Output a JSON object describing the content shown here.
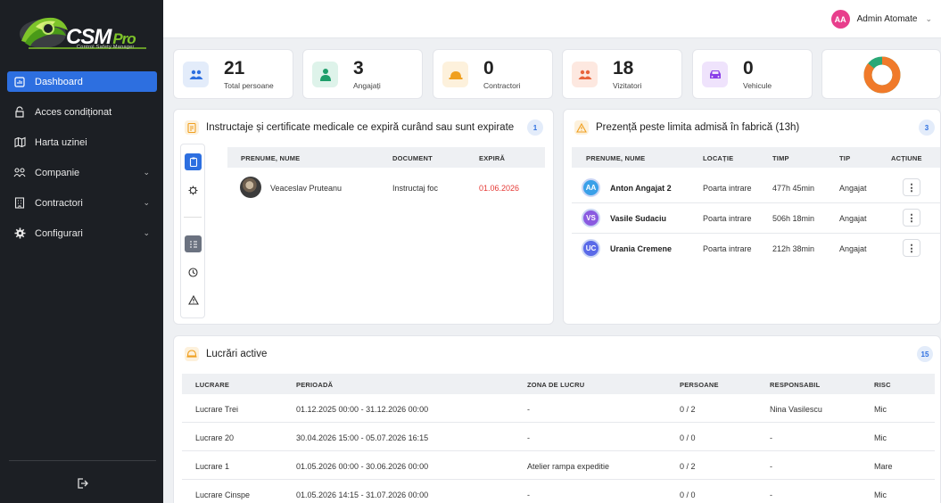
{
  "brand": {
    "name": "CSM",
    "suffix": "Pro",
    "tagline": "Control Safety Manager"
  },
  "sidebar": {
    "items": [
      {
        "label": "Dashboard",
        "active": true,
        "icon": "chart-icon"
      },
      {
        "label": "Acces condiționat",
        "icon": "key-icon"
      },
      {
        "label": "Harta uzinei",
        "icon": "map-icon"
      },
      {
        "label": "Companie",
        "icon": "users-icon",
        "expandable": true
      },
      {
        "label": "Contractori",
        "icon": "building-icon",
        "expandable": true
      },
      {
        "label": "Configurari",
        "icon": "gear-icon",
        "expandable": true
      }
    ]
  },
  "user": {
    "initials": "AA",
    "name": "Admin Atomate"
  },
  "stats": [
    {
      "value": "21",
      "label": "Total persoane",
      "icon": "users-icon",
      "color": "#2d6fe0",
      "bg": "#e3ecfa"
    },
    {
      "value": "3",
      "label": "Angajați",
      "icon": "employee-icon",
      "color": "#1e9e6a",
      "bg": "#def3ea"
    },
    {
      "value": "0",
      "label": "Contractori",
      "icon": "hardhat-icon",
      "color": "#f0a020",
      "bg": "#fdf1dc"
    },
    {
      "value": "18",
      "label": "Vizitatori",
      "icon": "visitors-icon",
      "color": "#e8643c",
      "bg": "#fde8e0"
    },
    {
      "value": "0",
      "label": "Vehicule",
      "icon": "car-icon",
      "color": "#8a3ee8",
      "bg": "#efe3fc"
    }
  ],
  "certs": {
    "title": "Instructaje și certificate medicale ce expiră curând sau sunt expirate",
    "count": "1",
    "headers": [
      "PRENUME, NUME",
      "DOCUMENT",
      "EXPIRĂ"
    ],
    "rows": [
      {
        "name": "Veaceslav Pruteanu",
        "document": "Instructaj foc",
        "expires": "01.06.2026"
      }
    ]
  },
  "presence": {
    "title": "Prezență peste limita admisă în fabrică (13h)",
    "count": "3",
    "headers": [
      "PRENUME, NUME",
      "LOCAȚIE",
      "TIMP",
      "TIP",
      "ACȚIUNE"
    ],
    "rows": [
      {
        "initials": "AA",
        "name": "Anton Angajat 2",
        "location": "Poarta intrare",
        "time": "477h 45min",
        "type": "Angajat",
        "color": "#3aa0e8"
      },
      {
        "initials": "VS",
        "name": "Vasile Sudaciu",
        "location": "Poarta intrare",
        "time": "506h 18min",
        "type": "Angajat",
        "color": "#8a5ae0"
      },
      {
        "initials": "UC",
        "name": "Urania Cremene",
        "location": "Poarta intrare",
        "time": "212h 38min",
        "type": "Angajat",
        "color": "#5a6ae8"
      }
    ]
  },
  "works": {
    "title": "Lucrări active",
    "count": "15",
    "headers": [
      "LUCRARE",
      "PERIOADĂ",
      "ZONA DE LUCRU",
      "PERSOANE",
      "RESPONSABIL",
      "RISC"
    ],
    "rows": [
      {
        "name": "Lucrare Trei",
        "period": "01.12.2025 00:00 - 31.12.2026 00:00",
        "zone": "-",
        "persons": "0 / 2",
        "responsible": "Nina Vasilescu",
        "risk": "Mic"
      },
      {
        "name": "Lucrare 20",
        "period": "30.04.2026 15:00 - 05.07.2026 16:15",
        "zone": "-",
        "persons": "0 / 0",
        "responsible": "-",
        "risk": "Mic"
      },
      {
        "name": "Lucrare 1",
        "period": "01.05.2026 00:00 - 30.06.2026 00:00",
        "zone": "Atelier rampa expeditie",
        "persons": "0 / 2",
        "responsible": "-",
        "risk": "Mare"
      },
      {
        "name": "Lucrare Cinspe",
        "period": "01.05.2026 14:15 - 31.07.2026 00:00",
        "zone": "-",
        "persons": "0 / 0",
        "responsible": "-",
        "risk": "Mic"
      }
    ]
  },
  "colors": {
    "accent": "#2d6fe0",
    "expired": "#e53935",
    "donut_main": "#f07a2a",
    "donut_rest": "#2aa876"
  }
}
